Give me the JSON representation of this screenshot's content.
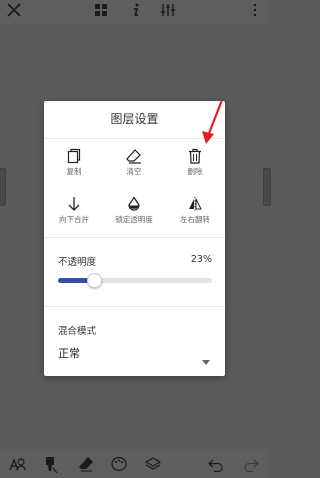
{
  "top_bar": {
    "close_icon": "close-icon",
    "layers_icon": "layers-grid-icon",
    "info_icon": "info-icon",
    "adjust_icon": "sliders-icon",
    "more_icon": "more-vertical-icon"
  },
  "dialog": {
    "title": "图层设置",
    "actions_row1": [
      {
        "label": "复制",
        "icon": "copy-icon"
      },
      {
        "label": "清空",
        "icon": "eraser-icon"
      },
      {
        "label": "删除",
        "icon": "trash-icon"
      }
    ],
    "actions_row2": [
      {
        "label": "向下合并",
        "icon": "arrow-down-icon"
      },
      {
        "label": "锁定透明度",
        "icon": "drop-icon"
      },
      {
        "label": "左右翻转",
        "icon": "flip-horizontal-icon"
      }
    ],
    "opacity": {
      "label": "不透明度",
      "value_text": "23%",
      "value": 0.23
    },
    "blend_mode": {
      "label": "混合模式",
      "selected": "正常"
    }
  },
  "bottom_bar": {
    "icons": [
      "user-brush-icon",
      "brush-icon",
      "eraser-icon",
      "palette-icon",
      "layers-icon",
      "undo-icon",
      "redo-icon"
    ]
  },
  "colors": {
    "background": "#5b5b5b",
    "slider_fill": "#3a4fa6",
    "annotation_arrow": "#e02020"
  }
}
